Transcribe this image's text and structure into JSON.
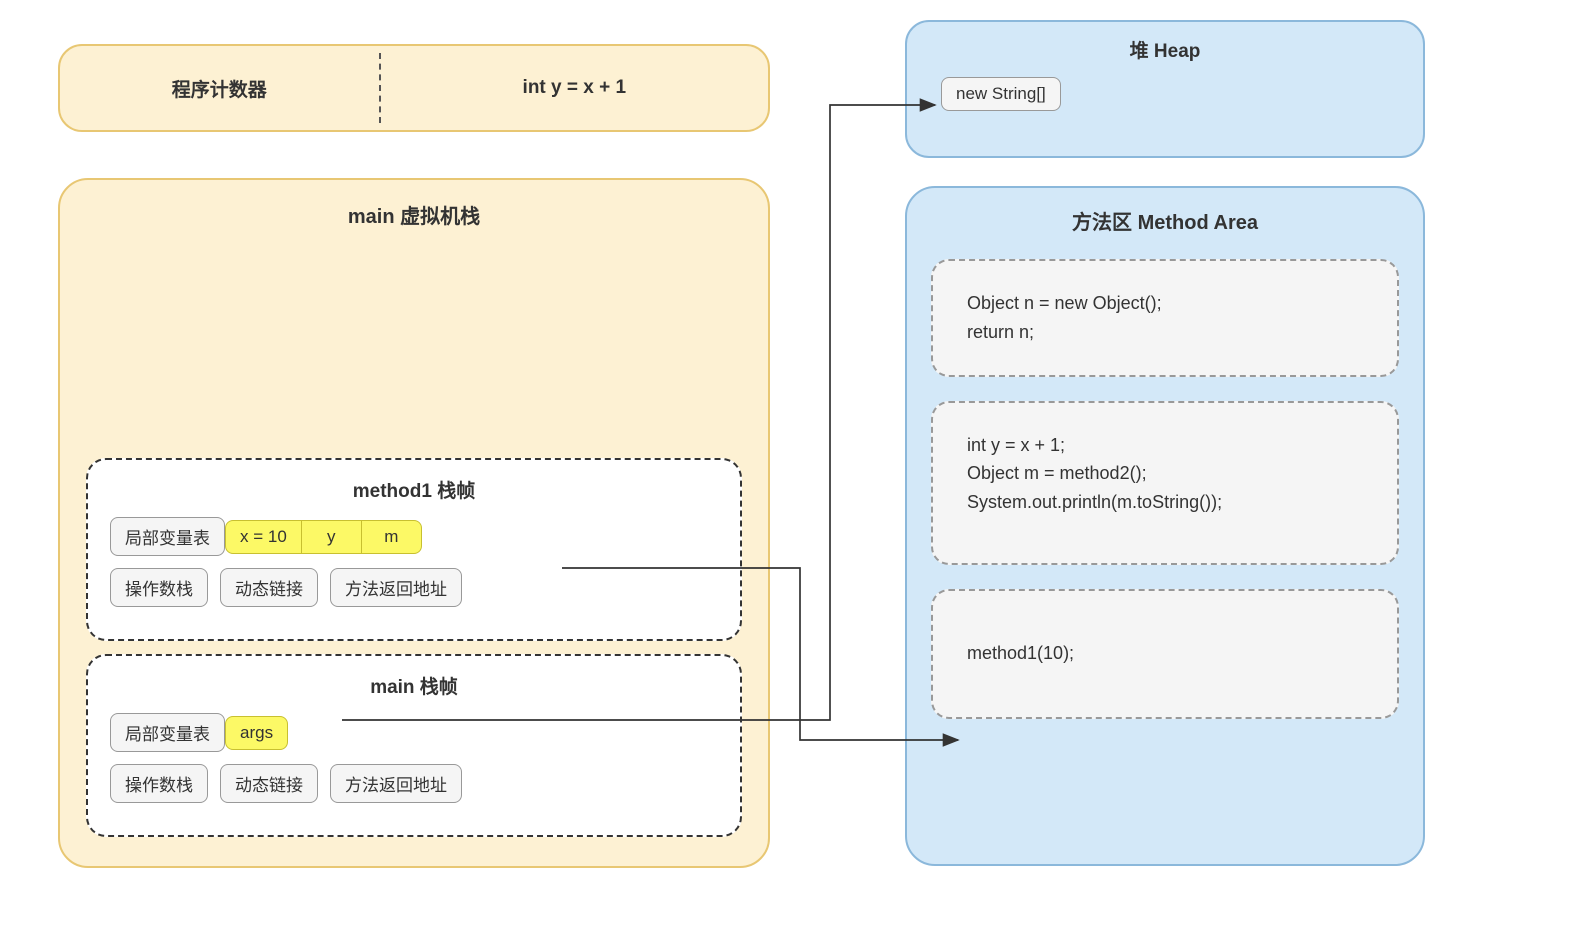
{
  "pc": {
    "label": "程序计数器",
    "instruction": "int y = x + 1"
  },
  "stack": {
    "title": "main 虚拟机栈",
    "frame1": {
      "title": "method1 栈帧",
      "localVarsLabel": "局部变量表",
      "vars": [
        "x = 10",
        "y",
        "m"
      ],
      "operandStack": "操作数栈",
      "dynamicLink": "动态链接",
      "returnAddr": "方法返回地址"
    },
    "frameMain": {
      "title": "main 栈帧",
      "localVarsLabel": "局部变量表",
      "vars": [
        "args"
      ],
      "operandStack": "操作数栈",
      "dynamicLink": "动态链接",
      "returnAddr": "方法返回地址"
    }
  },
  "heap": {
    "title": "堆 Heap",
    "object": "new String[]"
  },
  "methodArea": {
    "title": "方法区 Method Area",
    "block1": "Object n = new Object();\nreturn n;",
    "block2": "int y = x + 1;\nObject m = method2();\nSystem.out.println(m.toString());",
    "block3": "method1(10);"
  }
}
